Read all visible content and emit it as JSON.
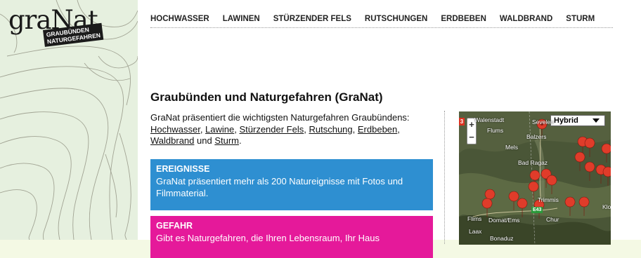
{
  "logo": {
    "word": "graNat",
    "tag_line1": "GRAUBÜNDEN",
    "tag_line2": "NATURGEFAHREN"
  },
  "nav": [
    {
      "label": "HOCHWASSER"
    },
    {
      "label": "LAWINEN"
    },
    {
      "label": "STÜRZENDER FELS"
    },
    {
      "label": "RUTSCHUNGEN"
    },
    {
      "label": "ERDBEBEN"
    },
    {
      "label": "WALDBRAND"
    },
    {
      "label": "STURM"
    }
  ],
  "page_title": "Graubünden und Naturgefahren (GraNat)",
  "intro": {
    "lead": "GraNat präsentiert die wichtigsten Naturgefahren Graubündens:",
    "links": [
      "Hochwasser",
      "Lawine",
      "Stürzender Fels",
      "Rutschung",
      "Erdbeben",
      "Waldbrand",
      "Sturm"
    ],
    "sep_comma": ", ",
    "sep_and": " und ",
    "end": "."
  },
  "boxes": {
    "ereignisse": {
      "title": "EREIGNISSE",
      "text": "GraNat präsentiert mehr als 200 Natureignisse mit Fotos und Filmmaterial."
    },
    "gefahr": {
      "title": "GEFAHR",
      "text": "Gibt es Naturgefahren, die Ihren Lebensraum, Ihr Haus"
    }
  },
  "map": {
    "type_select": "Hybrid",
    "zoom_in": "+",
    "zoom_out": "−",
    "badge": "3",
    "route": "E43",
    "places": [
      "Walenstadt",
      "Sevelen",
      "Flums",
      "Balzers",
      "Mels",
      "Bad Ragaz",
      "Trimmis",
      "Chur",
      "Domat/Ems",
      "Flims",
      "Laax",
      "Bonaduz",
      "Klo"
    ]
  },
  "colors": {
    "ereignisse": "#2e8fd1",
    "gefahr": "#e5199a",
    "marker": "#e03c2a"
  }
}
